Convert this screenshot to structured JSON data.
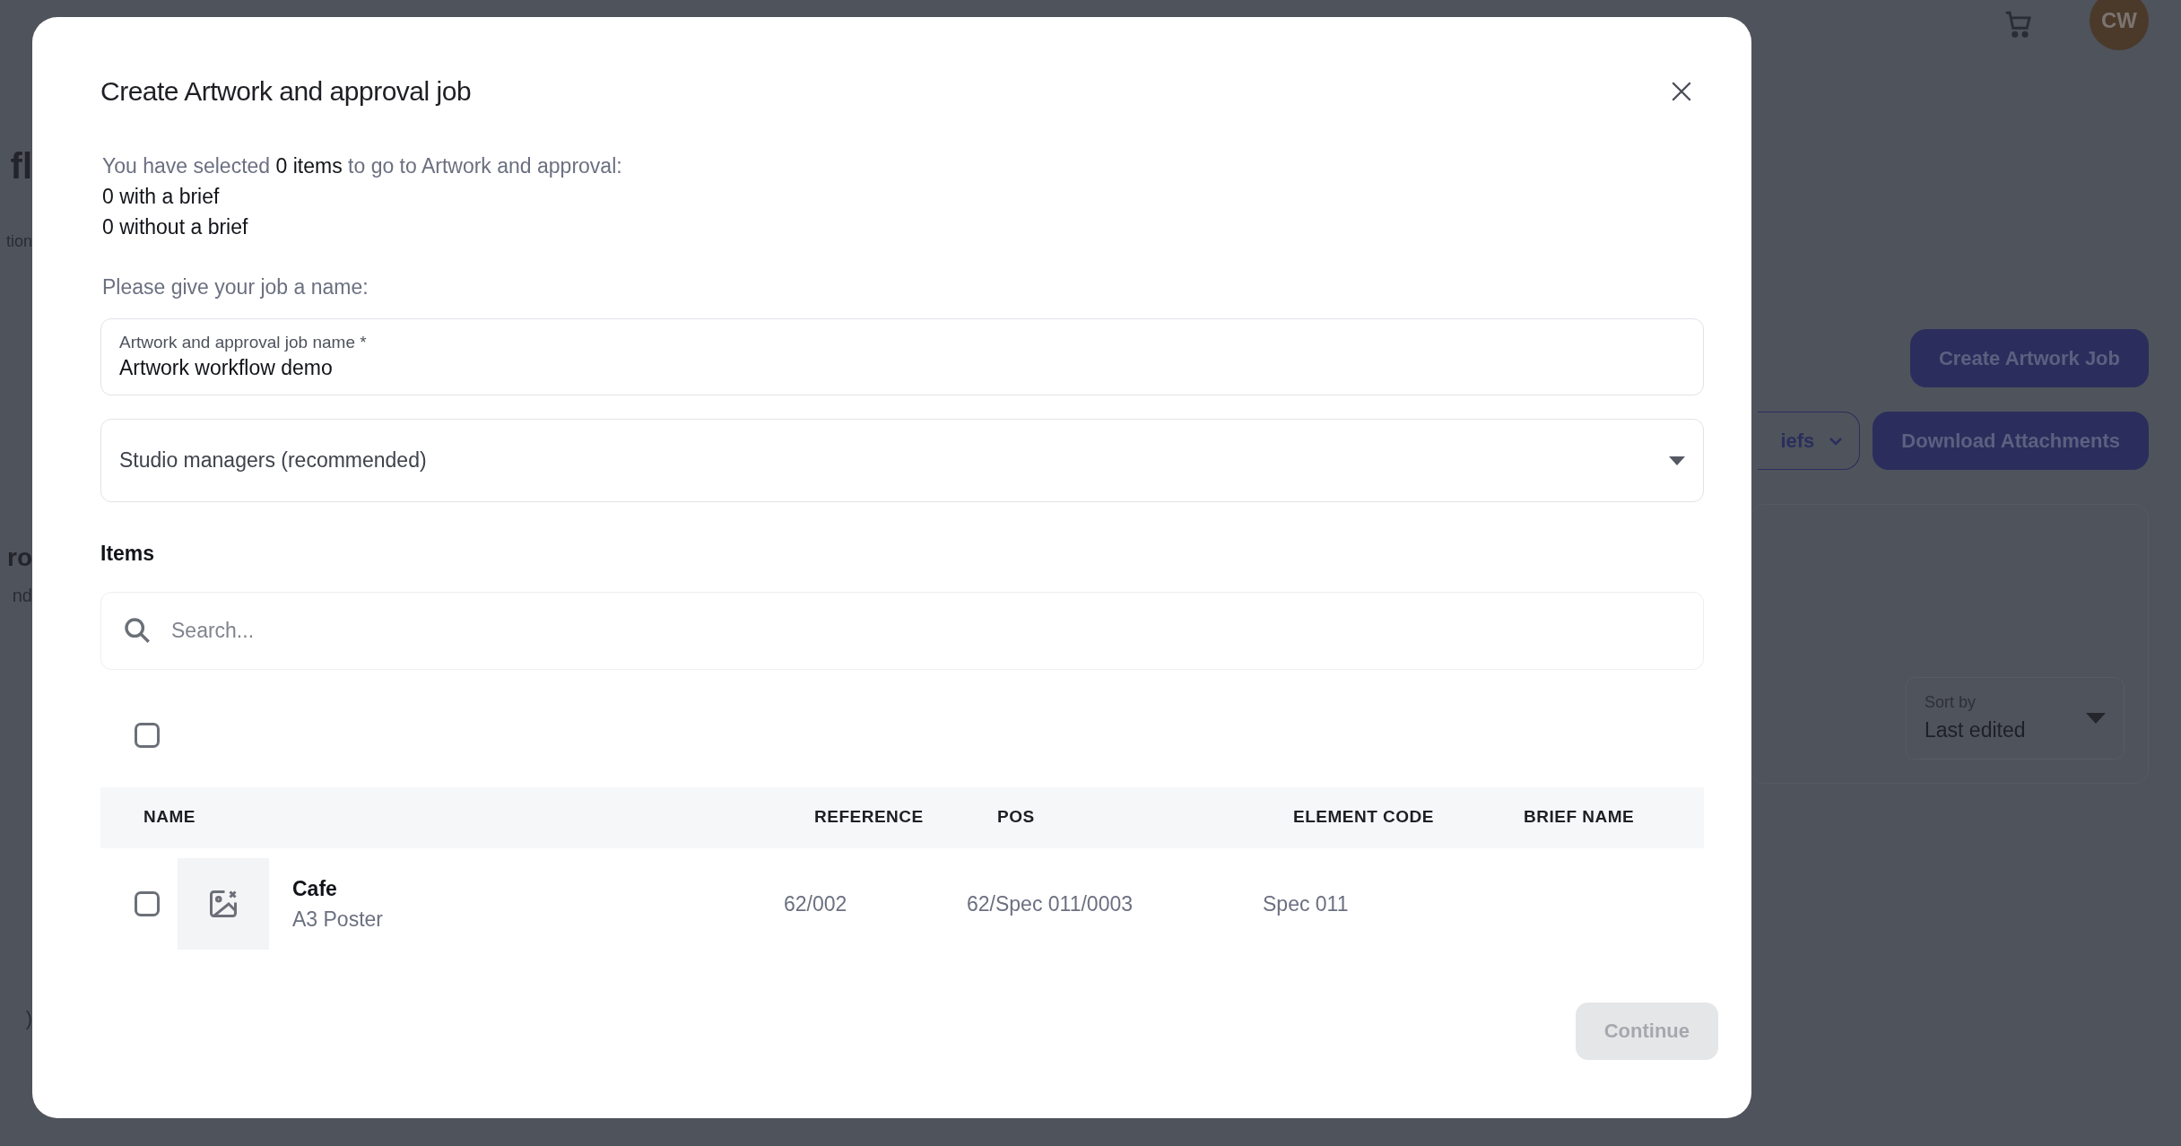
{
  "background": {
    "title_fragment": "fl",
    "subtitle_fragment": "tion",
    "section_fragment": "ro",
    "section_text_fragment": "nd",
    "footer_fragment": ")",
    "avatar": "CW",
    "create_button": "Create Artwork Job",
    "filter_button": "iefs",
    "download_button": "Download Attachments",
    "sort": {
      "label": "Sort by",
      "value": "Last edited"
    }
  },
  "dialog": {
    "title": "Create Artwork and approval job",
    "summary": "You have selected **0 items** to go to Artwork and approval:",
    "with_brief": "0 with a brief",
    "without_brief": "0 without a brief",
    "name_prompt": "Please give your job a name:",
    "name_field": {
      "label": "Artwork and approval job name *",
      "value": "Artwork workflow demo"
    },
    "group_select": {
      "value": "Studio managers (recommended)"
    },
    "items_heading": "Items",
    "search": {
      "placeholder": "Search..."
    },
    "select_all": {
      "checked": false
    },
    "table": {
      "columns": [
        "NAME",
        "REFERENCE",
        "POS",
        "ELEMENT CODE",
        "BRIEF NAME"
      ],
      "rows": [
        {
          "checked": false,
          "name": "Cafe",
          "subtitle": "A3 Poster",
          "reference": "62/002",
          "pos": "62/Spec 011/0003",
          "element_code": "Spec 011"
        }
      ]
    },
    "continue_button": {
      "label": "Continue",
      "disabled": true
    }
  }
}
